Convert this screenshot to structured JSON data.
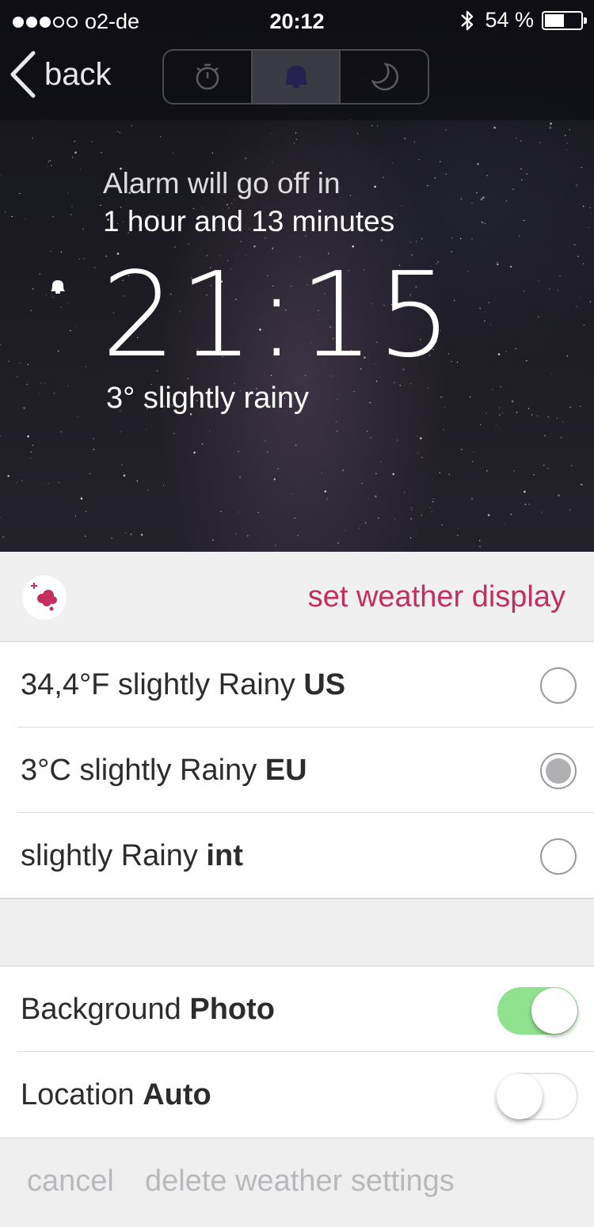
{
  "status_bar": {
    "carrier": "o2-de",
    "signal_bars": 3,
    "signal_total": 5,
    "time": "20:12",
    "battery_text": "54 %",
    "battery_level": 0.54
  },
  "nav": {
    "back_label": "back",
    "segments": [
      "stopwatch-icon",
      "bell-icon",
      "moon-icon"
    ],
    "selected_segment": 1
  },
  "alarm": {
    "caption_line1": "Alarm will go off in",
    "caption_line2": "1 hour and 13 minutes",
    "time": "21:15",
    "weather": "3° slightly rainy"
  },
  "weather_panel": {
    "title": "set weather display",
    "accent_color": "#c4305e",
    "options": [
      {
        "text": "34,4°F slightly Rainy ",
        "bold": "US",
        "selected": false
      },
      {
        "text": "3°C slightly Rainy ",
        "bold": "EU",
        "selected": true
      },
      {
        "text": "slightly Rainy ",
        "bold": "int",
        "selected": false
      }
    ]
  },
  "settings": [
    {
      "text": "Background ",
      "bold": "Photo",
      "on": true
    },
    {
      "text": "Location ",
      "bold": "Auto",
      "on": false
    }
  ],
  "footer": {
    "cancel_label": "cancel",
    "delete_label": "delete weather settings"
  }
}
